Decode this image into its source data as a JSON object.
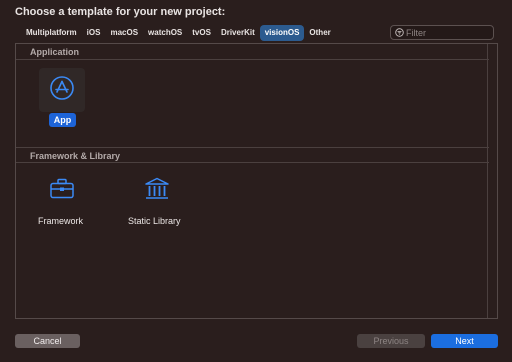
{
  "header": {
    "title": "Choose a template for your new project:"
  },
  "tabs": [
    {
      "label": "Multiplatform"
    },
    {
      "label": "iOS"
    },
    {
      "label": "macOS"
    },
    {
      "label": "watchOS"
    },
    {
      "label": "tvOS"
    },
    {
      "label": "DriverKit"
    },
    {
      "label": "visionOS",
      "selected": true
    },
    {
      "label": "Other"
    }
  ],
  "filter": {
    "placeholder": "Filter",
    "value": ""
  },
  "sections": {
    "application": {
      "title": "Application",
      "items": [
        {
          "label": "App",
          "icon": "app-store-icon",
          "selected": true
        }
      ]
    },
    "framework_library": {
      "title": "Framework & Library",
      "items": [
        {
          "label": "Framework",
          "icon": "toolbox-icon"
        },
        {
          "label": "Static Library",
          "icon": "library-columns-icon"
        }
      ]
    }
  },
  "footer": {
    "cancel_label": "Cancel",
    "previous_label": "Previous",
    "next_label": "Next"
  },
  "colors": {
    "accent": "#1d64d8",
    "icon_blue": "#3b8af5",
    "selected_tab": "#2c5b8f",
    "background": "#2a1e1d"
  }
}
